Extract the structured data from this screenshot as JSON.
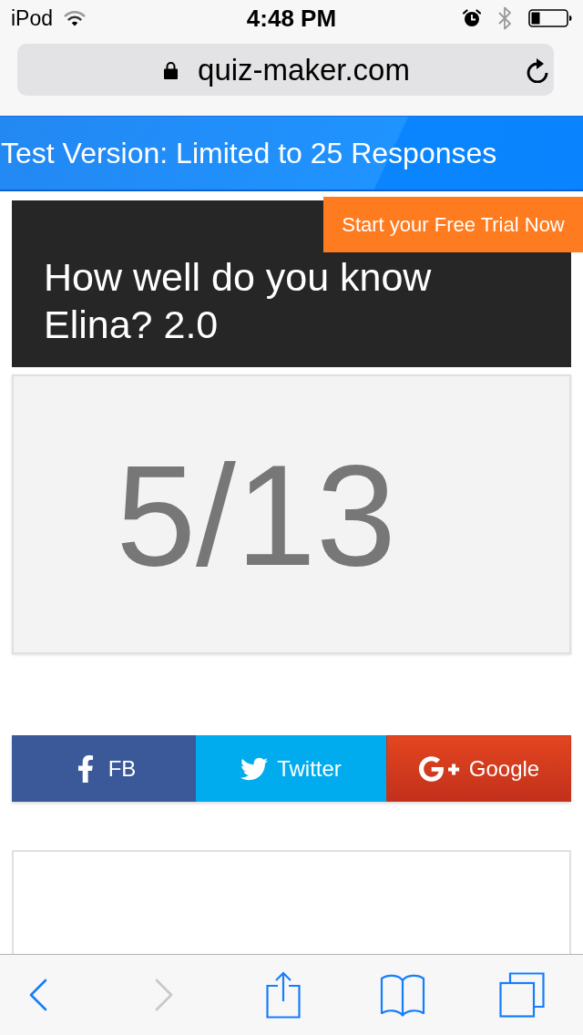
{
  "status_bar": {
    "carrier": "iPod",
    "time": "4:48 PM"
  },
  "address_bar": {
    "url": "quiz-maker.com",
    "secure": true
  },
  "banner": {
    "text": "Test Version: Limited to 25 Responses"
  },
  "trial_button": {
    "label": "Start your Free Trial Now"
  },
  "quiz": {
    "title": "How well do you know Elina? 2.0",
    "score": "5/13"
  },
  "share_buttons": [
    {
      "kind": "facebook",
      "label": "FB"
    },
    {
      "kind": "twitter",
      "label": "Twitter"
    },
    {
      "kind": "google",
      "label": "Google"
    }
  ],
  "toolbar": {
    "buttons": [
      {
        "kind": "back",
        "disabled": false
      },
      {
        "kind": "forward",
        "disabled": true
      },
      {
        "kind": "share",
        "disabled": false
      },
      {
        "kind": "bookmarks",
        "disabled": false
      },
      {
        "kind": "tabs",
        "disabled": false
      }
    ]
  }
}
